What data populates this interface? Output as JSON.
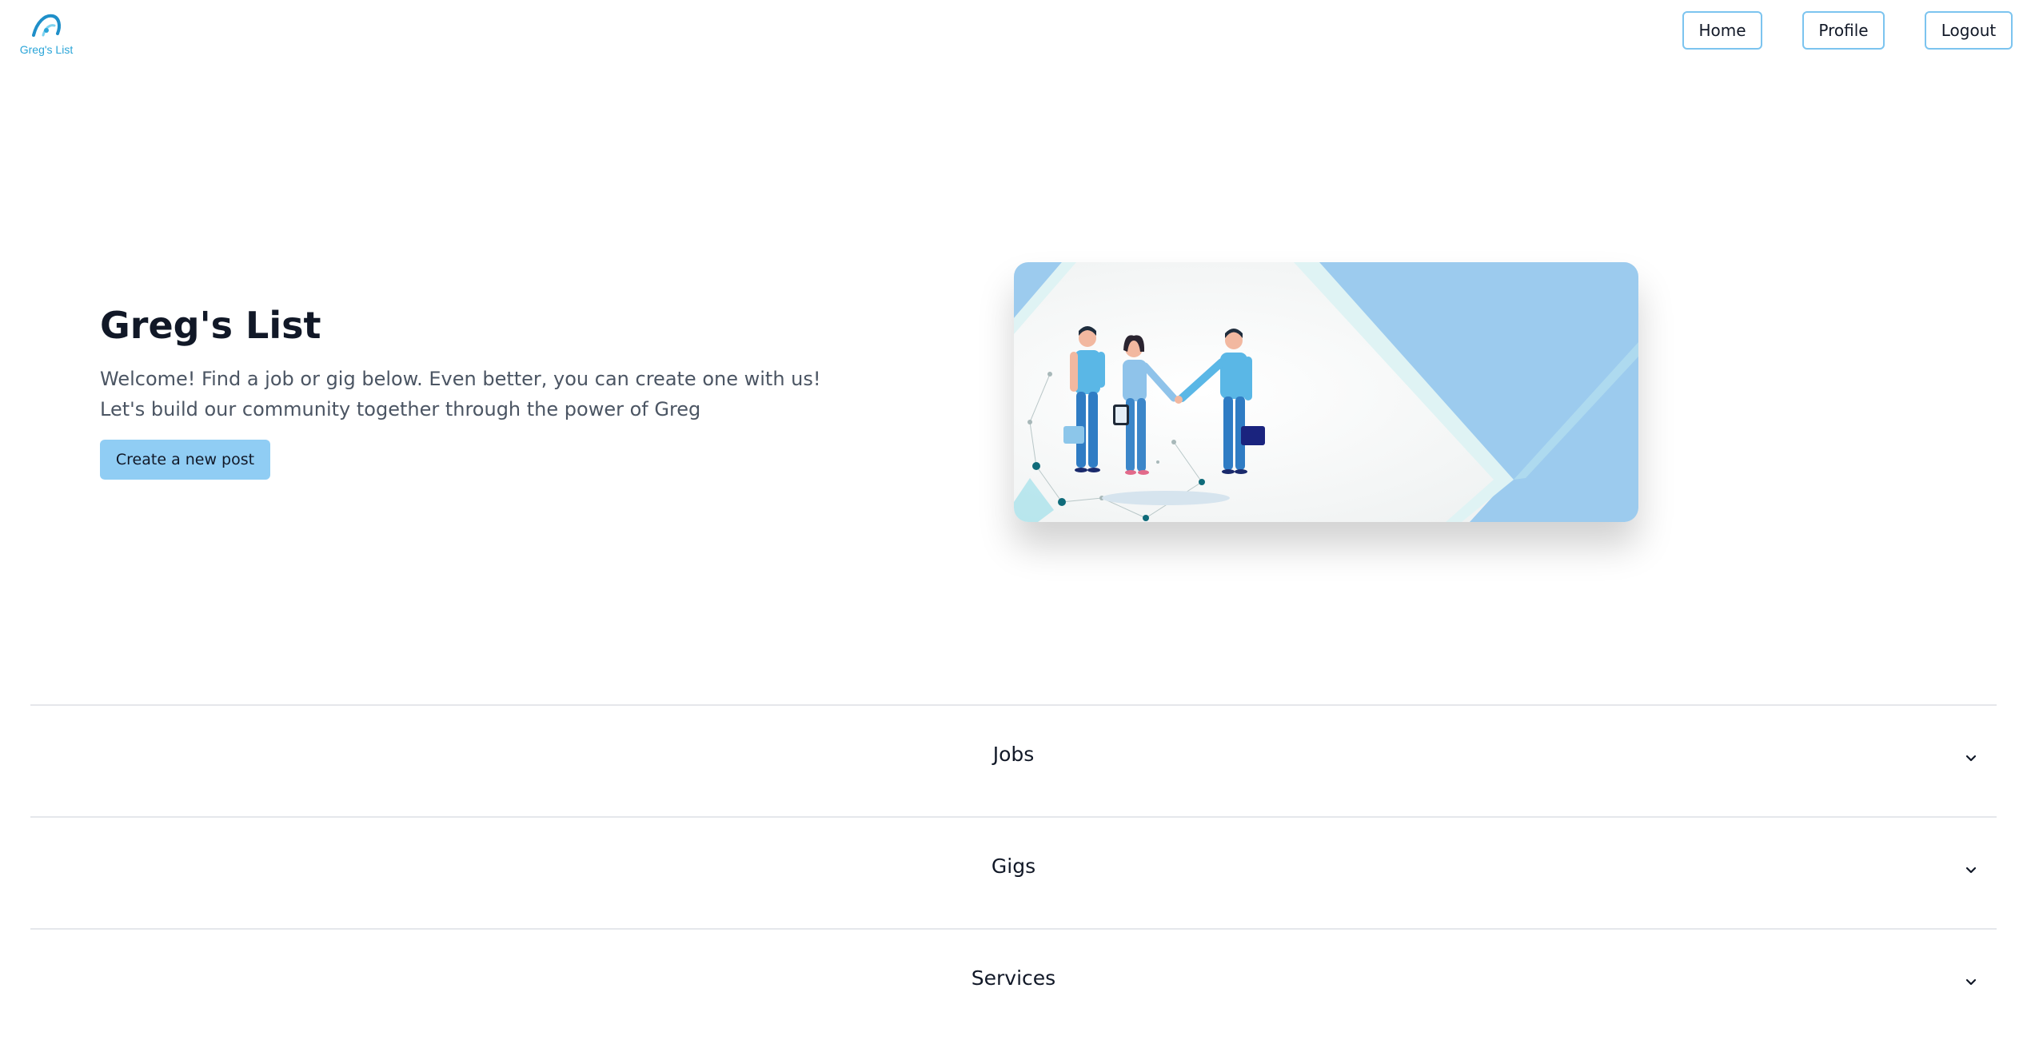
{
  "header": {
    "logo_text": "Greg's List",
    "nav": [
      {
        "label": "Home"
      },
      {
        "label": "Profile"
      },
      {
        "label": "Logout"
      }
    ]
  },
  "hero": {
    "title": "Greg's List",
    "description": "Welcome! Find a job or gig below. Even better, you can create one with us! Let's build our community together through the power of Greg",
    "cta_label": "Create a new post",
    "cta_color": "#90cdf4"
  },
  "accordion": {
    "items": [
      {
        "label": "Jobs",
        "icon": "chevron-down-icon"
      },
      {
        "label": "Gigs",
        "icon": "chevron-down-icon"
      },
      {
        "label": "Services",
        "icon": "chevron-down-icon"
      }
    ]
  },
  "colors": {
    "accent_border": "#7cc4ef",
    "logo_blue": "#2aa5d8",
    "illustration_blue": "#9ccbee"
  }
}
